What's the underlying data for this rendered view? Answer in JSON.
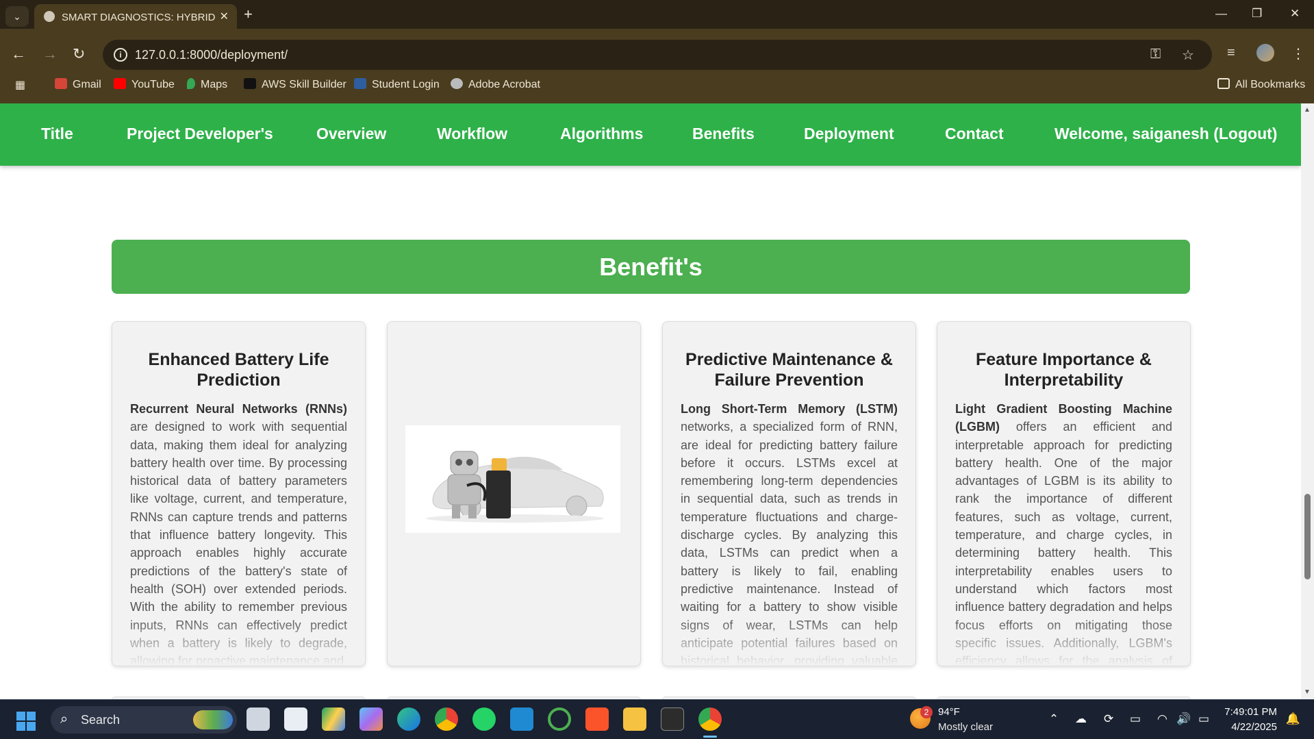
{
  "browser": {
    "tab_title": "SMART DIAGNOSTICS: HYBRID",
    "url": "127.0.0.1:8000/deployment/",
    "bookmarks": [
      "Gmail",
      "YouTube",
      "Maps",
      "AWS Skill Builder",
      "Student Login",
      "Adobe Acrobat"
    ],
    "all_bookmarks": "All Bookmarks"
  },
  "nav": {
    "items": [
      "Title",
      "Project Developer's",
      "Overview",
      "Workflow",
      "Algorithms",
      "Benefits",
      "Deployment",
      "Contact"
    ],
    "welcome": "Welcome, saiganesh (Logout)"
  },
  "section": {
    "title": "Benefit's"
  },
  "cards": [
    {
      "title": "Enhanced Battery Life Prediction",
      "lead": "Recurrent Neural Networks (RNNs)",
      "text": " are designed to work with sequential data, making them ideal for analyzing battery health over time. By processing historical data of battery parameters like voltage, current, and temperature, RNNs can capture trends and patterns that influence battery longevity. This approach enables highly accurate predictions of the battery's state of health (SOH) over extended periods. With the ability to remember previous inputs, RNNs can effectively predict when a battery is likely to degrade, allowing for proactive maintenance and"
    },
    {
      "title": "Predictive Maintenance & Failure Prevention",
      "lead": "Long Short-Term Memory (LSTM)",
      "text": " networks, a specialized form of RNN, are ideal for predicting battery failure before it occurs. LSTMs excel at remembering long-term dependencies in sequential data, such as trends in temperature fluctuations and charge-discharge cycles. By analyzing this data, LSTMs can predict when a battery is likely to fail, enabling predictive maintenance. Instead of waiting for a battery to show visible signs of wear, LSTMs can help anticipate potential failures based on historical behavior, providing valuable time to address the issue before it leads to an"
    },
    {
      "title": "Feature Importance & Interpretability",
      "lead": "Light Gradient Boosting Machine (LGBM)",
      "text": " offers an efficient and interpretable approach for predicting battery health. One of the major advantages of LGBM is its ability to rank the importance of different features, such as voltage, current, temperature, and charge cycles, in determining battery health. This interpretability enables users to understand which factors most influence battery degradation and helps focus efforts on mitigating those specific issues. Additionally, LGBM's efficiency allows for the analysis of large datasets quickly"
    }
  ],
  "taskbar": {
    "search_label": "Search",
    "weather_badge": "2",
    "weather_temp": "94°F",
    "weather_desc": "Mostly clear",
    "time": "7:49:01 PM",
    "date": "4/22/2025"
  }
}
